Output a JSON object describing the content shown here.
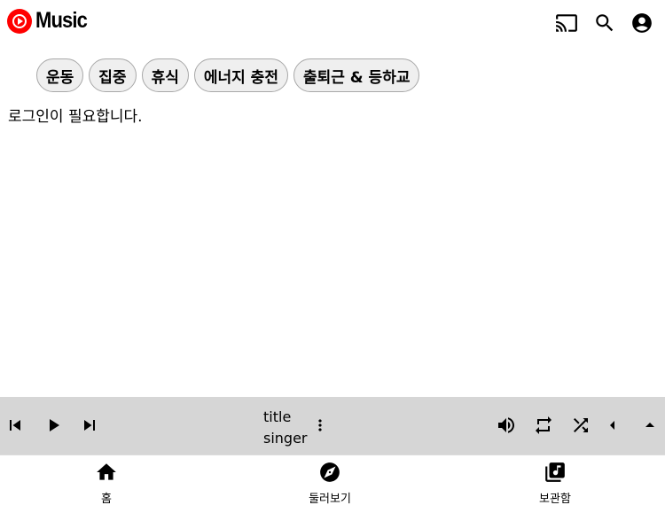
{
  "header": {
    "logo_text": "Music",
    "icons": [
      "cast-icon",
      "search-icon",
      "account-icon"
    ]
  },
  "chips": [
    {
      "label": "운동"
    },
    {
      "label": "집중"
    },
    {
      "label": "휴식"
    },
    {
      "label": "에너지 충전"
    },
    {
      "label": "출퇴근 & 등하교"
    }
  ],
  "main": {
    "login_message": "로그인이 필요합니다."
  },
  "player": {
    "title": "title",
    "singer": "singer",
    "controls_left": [
      "skip-previous-icon",
      "play-icon",
      "skip-next-icon"
    ],
    "controls_right": [
      "volume-icon",
      "repeat-icon",
      "shuffle-icon",
      "caret-left-icon",
      "caret-up-icon"
    ]
  },
  "bottom_nav": [
    {
      "label": "홈",
      "icon": "home-icon"
    },
    {
      "label": "둘러보기",
      "icon": "explore-icon"
    },
    {
      "label": "보관함",
      "icon": "library-icon"
    }
  ],
  "colors": {
    "brand": "#ff0000",
    "player_bg": "#d6d6d6",
    "chip_bg": "#efefef"
  }
}
